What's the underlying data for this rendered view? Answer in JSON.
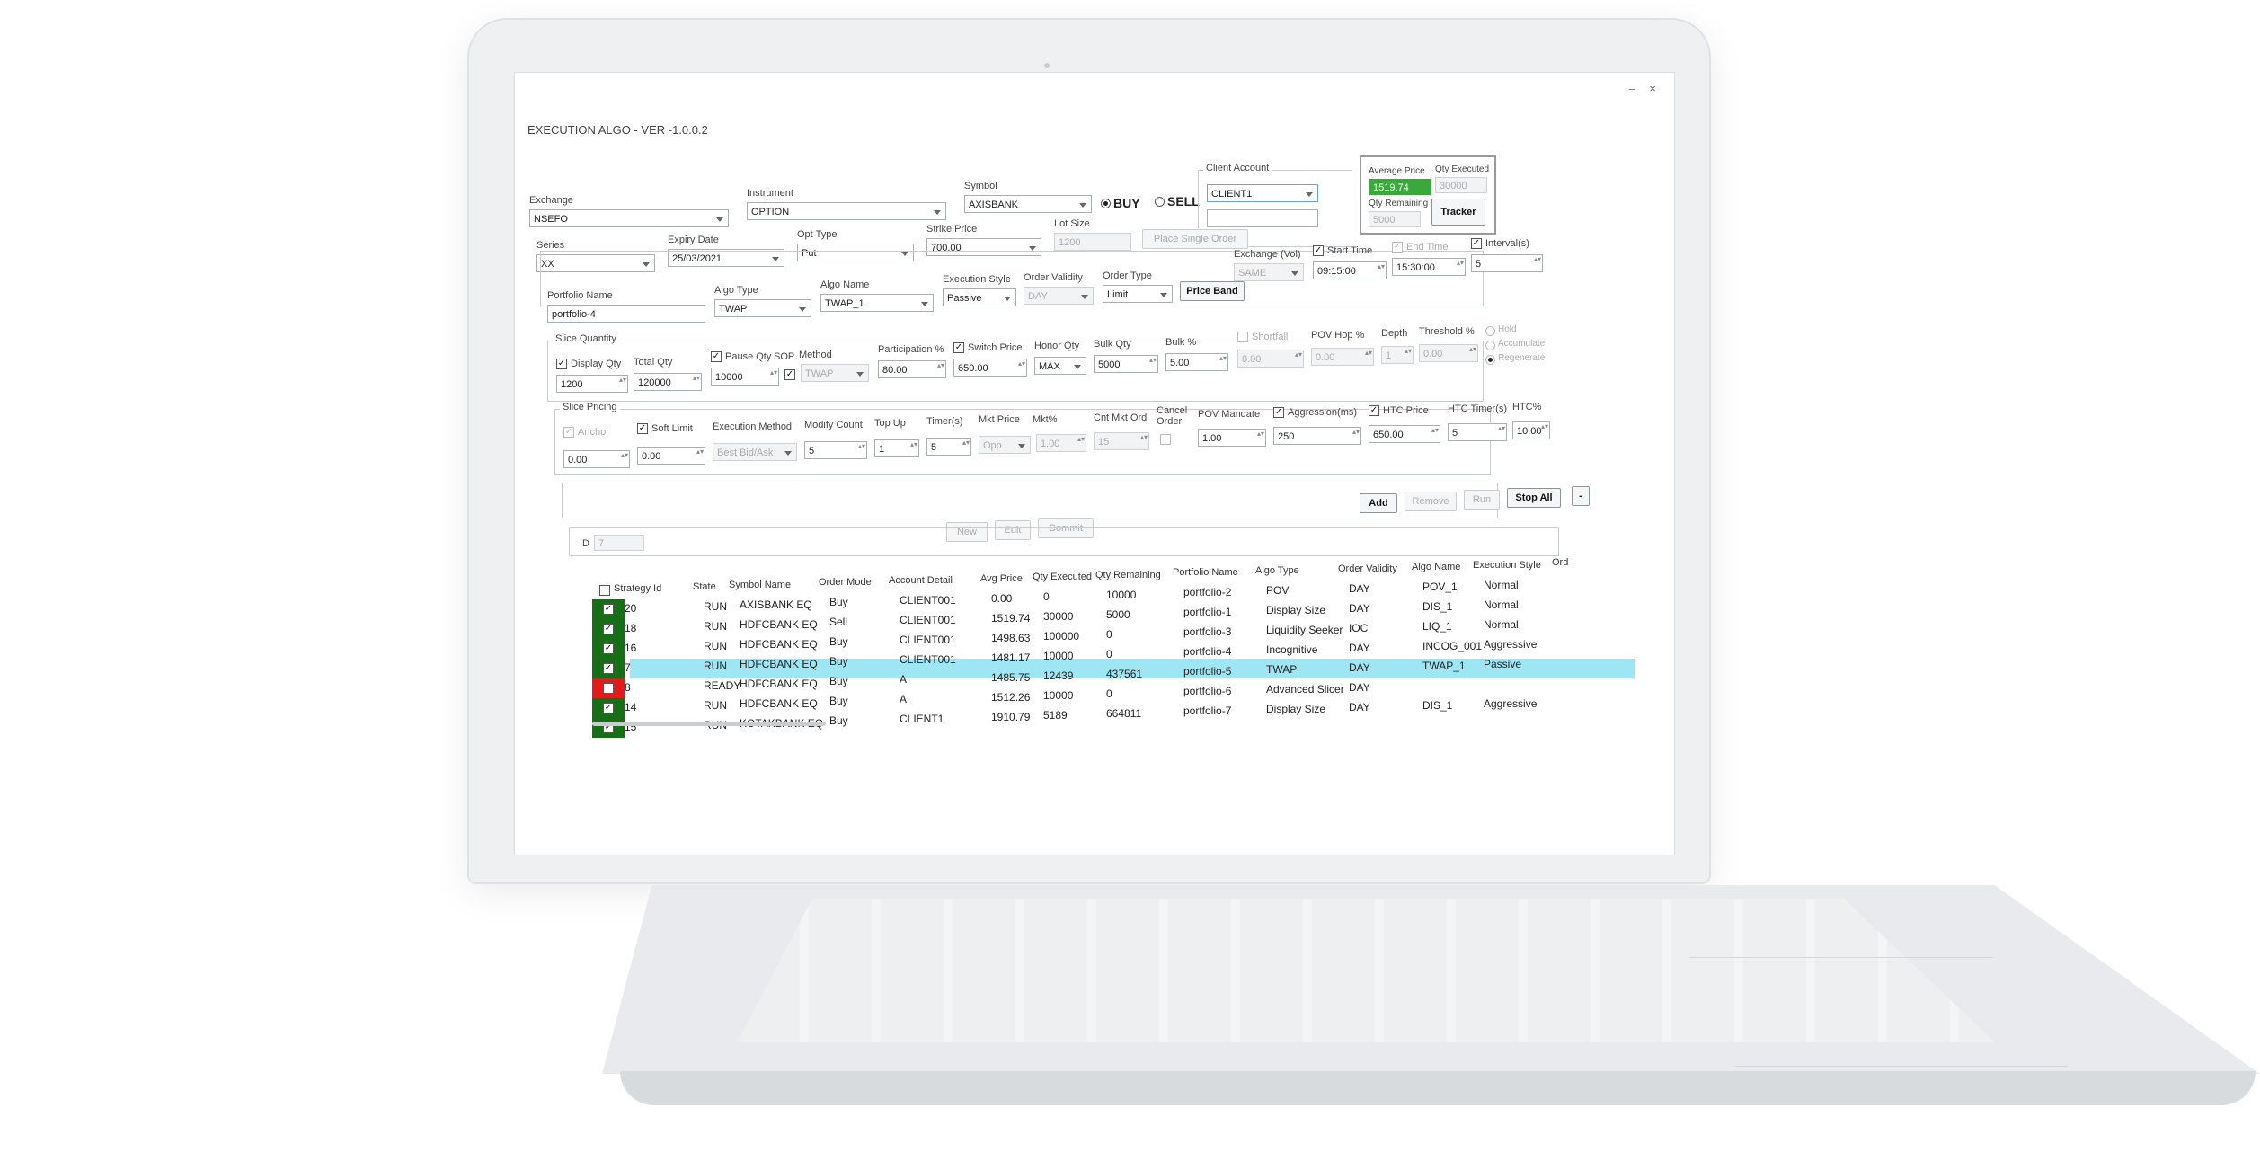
{
  "app": {
    "title": "EXECUTION ALGO - VER -1.0.0.2",
    "window_controls": "–  ×"
  },
  "order": {
    "exchange_label": "Exchange",
    "exchange": "NSEFO",
    "instrument_label": "Instrument",
    "instrument": "OPTION",
    "symbol_label": "Symbol",
    "symbol": "AXISBANK",
    "buy_label": "BUY",
    "sell_label": "SELL",
    "series_label": "Series",
    "series": "XX",
    "expiry_label": "Expiry Date",
    "expiry": "25/03/2021",
    "opt_type_label": "Opt Type",
    "opt_type": "Put",
    "strike_label": "Strike Price",
    "strike": "700.00",
    "lot_size_label": "Lot Size",
    "lot_size": "1200",
    "place_single_order": "Place Single Order",
    "client_account_label": "Client Account",
    "client_account": "CLIENT1"
  },
  "tracker": {
    "avg_price_label": "Average Price",
    "avg_price": "1519.74",
    "qty_executed_label": "Qty Executed",
    "qty_executed": "30000",
    "qty_remaining_label": "Qty Remaining",
    "qty_remaining": "5000",
    "tracker_button": "Tracker"
  },
  "algo": {
    "portfolio_label": "Portfolio Name",
    "portfolio": "portfolio-4",
    "algo_type_label": "Algo Type",
    "algo_type": "TWAP",
    "algo_name_label": "Algo Name",
    "algo_name": "TWAP_1",
    "exec_style_label": "Execution Style",
    "exec_style": "Passive",
    "order_validity_label": "Order Validity",
    "order_validity": "DAY",
    "order_type_label": "Order Type",
    "order_type": "Limit",
    "price_band": "Price Band",
    "exchange_vol_label": "Exchange (Vol)",
    "exchange_vol": "SAME",
    "start_time_label": "Start Time",
    "start_time": "09:15:00",
    "end_time_label": "End Time",
    "end_time": "15:30:00",
    "interval_label": "Interval(s)",
    "interval": "5"
  },
  "slice_qty": {
    "group_label": "Slice Quantity",
    "display_qty_label": "Display Qty",
    "display_qty": "1200",
    "total_qty_label": "Total Qty",
    "total_qty": "120000",
    "pause_qty_label": "Pause Qty",
    "pause_qty": "10000",
    "sop_label": "SOP",
    "method_label": "Method",
    "method": "TWAP",
    "participation_label": "Participation %",
    "participation": "80.00",
    "switch_price_label": "Switch Price",
    "switch_price": "650.00",
    "honor_qty_label": "Honor Qty",
    "honor_qty": "MAX",
    "bulk_qty_label": "Bulk Qty",
    "bulk_qty": "5000",
    "bulk_pct_label": "Bulk %",
    "bulk_pct": "5.00",
    "shortfall_label": "Shortfall",
    "shortfall": "0.00",
    "pov_hop_label": "POV Hop %",
    "pov_hop": "0.00",
    "depth_label": "Depth",
    "depth": "1",
    "threshold_label": "Threshold %",
    "threshold": "0.00",
    "hold_label": "Hold",
    "accumulate_label": "Accumulate",
    "regenerate_label": "Regenerate"
  },
  "slice_pricing": {
    "group_label": "Slice Pricing",
    "anchor_label": "Anchor",
    "anchor": "0.00",
    "soft_limit_label": "Soft Limit",
    "soft_limit": "0.00",
    "exec_method_label": "Execution Method",
    "exec_method": "Best Bid/Ask",
    "modify_count_label": "Modify Count",
    "modify_count": "5",
    "top_up_label": "Top Up",
    "top_up": "1",
    "timer_label": "Timer(s)",
    "timer": "5",
    "mkt_price_label": "Mkt Price",
    "mkt_price": "Opp",
    "mkt_pct_label": "Mkt%",
    "mkt_pct": "1.00",
    "cnt_mkt_ord_label": "Cnt Mkt Ord",
    "cnt_mkt_ord": "15",
    "cancel_order_label": "Cancel Order",
    "pov_mandate_label": "POV Mandate",
    "pov_mandate": "1.00",
    "aggression_label": "Aggression(ms)",
    "aggression": "250",
    "htc_price_label": "HTC Price",
    "htc_price": "650.00",
    "htc_timer_label": "HTC Timer(s)",
    "htc_timer": "5",
    "htc_pct_label": "HTC%",
    "htc_pct": "10.00"
  },
  "actions": {
    "add": "Add",
    "remove": "Remove",
    "run": "Run",
    "stop_all": "Stop All",
    "collapse": "-",
    "new": "New",
    "edit": "Edit",
    "commit": "Commit",
    "id_label": "ID",
    "id_value": "7"
  },
  "table": {
    "columns": [
      "Strategy Id",
      "State",
      "Symbol Name",
      "Order Mode",
      "Account Detail",
      "Avg Price",
      "Qty Executed",
      "Qty Remaining",
      "Portfolio Name",
      "Algo Type",
      "Order Validity",
      "Algo Name",
      "Execution Style",
      "Ord"
    ],
    "rows": [
      {
        "id": "20",
        "state": "RUN",
        "symbol": "AXISBANK EQ",
        "mode": "Buy",
        "account": "CLIENT001",
        "avg": "0.00",
        "exec": "0",
        "rem": "10000",
        "portfolio": "portfolio-2",
        "algo_type": "POV",
        "validity": "DAY",
        "algo_name": "POV_1",
        "style": "Normal"
      },
      {
        "id": "18",
        "state": "RUN",
        "symbol": "HDFCBANK EQ",
        "mode": "Sell",
        "account": "CLIENT001",
        "avg": "1519.74",
        "exec": "30000",
        "rem": "5000",
        "portfolio": "portfolio-1",
        "algo_type": "Display Size",
        "validity": "DAY",
        "algo_name": "DIS_1",
        "style": "Normal"
      },
      {
        "id": "16",
        "state": "RUN",
        "symbol": "HDFCBANK EQ",
        "mode": "Buy",
        "account": "CLIENT001",
        "avg": "1498.63",
        "exec": "100000",
        "rem": "0",
        "portfolio": "portfolio-3",
        "algo_type": "Liquidity Seeker",
        "validity": "IOC",
        "algo_name": "LIQ_1",
        "style": "Normal"
      },
      {
        "id": "7",
        "state": "RUN",
        "symbol": "HDFCBANK EQ",
        "mode": "Buy",
        "account": "CLIENT001",
        "avg": "1481.17",
        "exec": "10000",
        "rem": "0",
        "portfolio": "portfolio-4",
        "algo_type": "Incognitive",
        "validity": "DAY",
        "algo_name": "INCOG_001",
        "style": "Aggressive"
      },
      {
        "id": "8",
        "state": "READY",
        "symbol": "HDFCBANK EQ",
        "mode": "Buy",
        "account": "A",
        "avg": "1485.75",
        "exec": "12439",
        "rem": "437561",
        "portfolio": "portfolio-5",
        "algo_type": "TWAP",
        "validity": "DAY",
        "algo_name": "TWAP_1",
        "style": "Passive"
      },
      {
        "id": "14",
        "state": "RUN",
        "symbol": "HDFCBANK EQ",
        "mode": "Buy",
        "account": "A",
        "avg": "1512.26",
        "exec": "10000",
        "rem": "0",
        "portfolio": "portfolio-6",
        "algo_type": "Advanced Slicer",
        "validity": "DAY",
        "algo_name": "",
        "style": ""
      },
      {
        "id": "15",
        "state": "RUN",
        "symbol": "KOTAKBANK EQ",
        "mode": "Buy",
        "account": "CLIENT1",
        "avg": "1910.79",
        "exec": "5189",
        "rem": "664811",
        "portfolio": "portfolio-7",
        "algo_type": "Display Size",
        "validity": "DAY",
        "algo_name": "DIS_1",
        "style": "Aggressive"
      }
    ]
  },
  "colors": {
    "highlight": "#9fe6f5",
    "run_flag": "#176e17",
    "stopped_flag": "#e11b1b",
    "avg_price_bg": "#3aa83a"
  }
}
